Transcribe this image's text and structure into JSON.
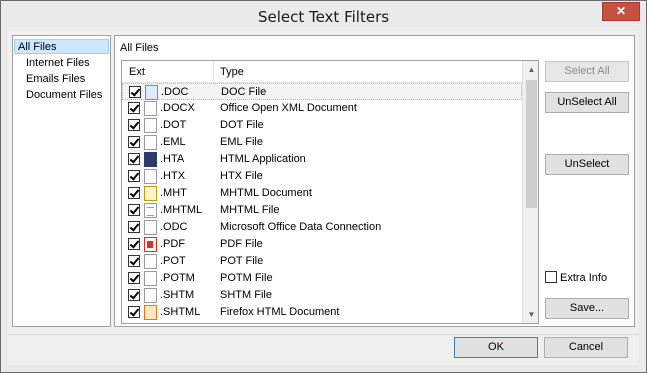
{
  "window": {
    "title": "Select Text Filters",
    "close_glyph": "✕"
  },
  "folders": {
    "items": [
      {
        "label": "All Files",
        "selected": true
      },
      {
        "label": "Internet Files",
        "selected": false
      },
      {
        "label": "Emails Files",
        "selected": false
      },
      {
        "label": "Document Files",
        "selected": false
      }
    ]
  },
  "files_panel": {
    "caption": "All Files",
    "columns": {
      "ext": "Ext",
      "type": "Type"
    },
    "rows": [
      {
        "ext": ".DOC",
        "type": "DOC File",
        "icon": "doc-icon",
        "checked": true
      },
      {
        "ext": ".DOCX",
        "type": "Office Open XML Document",
        "icon": "file-icon",
        "checked": true
      },
      {
        "ext": ".DOT",
        "type": "DOT File",
        "icon": "file-icon",
        "checked": true
      },
      {
        "ext": ".EML",
        "type": "EML File",
        "icon": "file-icon",
        "checked": true
      },
      {
        "ext": ".HTA",
        "type": "HTML Application",
        "icon": "hta-icon",
        "checked": true
      },
      {
        "ext": ".HTX",
        "type": "HTX File",
        "icon": "file-icon",
        "checked": true
      },
      {
        "ext": ".MHT",
        "type": "MHTML Document",
        "icon": "mht-icon",
        "checked": true
      },
      {
        "ext": ".MHTML",
        "type": "MHTML File",
        "icon": "lines-icon",
        "checked": true
      },
      {
        "ext": ".ODC",
        "type": "Microsoft Office Data Connection",
        "icon": "file-icon",
        "checked": true
      },
      {
        "ext": ".PDF",
        "type": "PDF File",
        "icon": "pdf-icon",
        "checked": true
      },
      {
        "ext": ".POT",
        "type": "POT File",
        "icon": "file-icon",
        "checked": true
      },
      {
        "ext": ".POTM",
        "type": "POTM File",
        "icon": "file-icon",
        "checked": true
      },
      {
        "ext": ".SHTM",
        "type": "SHTM File",
        "icon": "file-icon",
        "checked": true
      },
      {
        "ext": ".SHTML",
        "type": "Firefox HTML Document",
        "icon": "firefox-icon",
        "checked": true
      }
    ]
  },
  "buttons": {
    "select_all": "Select All",
    "unselect_all": "UnSelect All",
    "unselect": "UnSelect",
    "extra_info": "Extra Info",
    "save": "Save...",
    "ok": "OK",
    "cancel": "Cancel"
  }
}
